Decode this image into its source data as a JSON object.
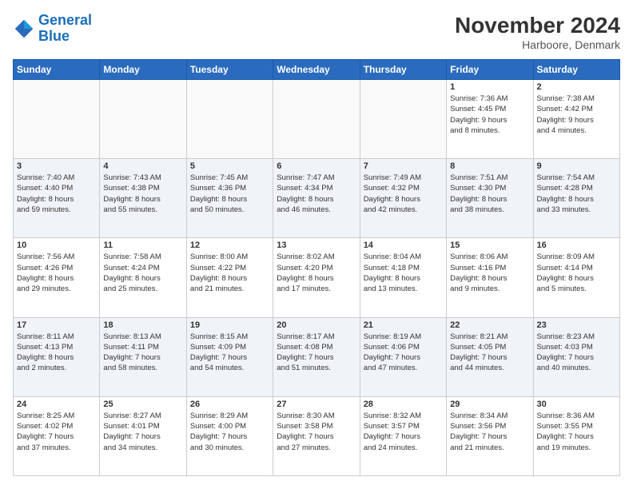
{
  "header": {
    "logo_line1": "General",
    "logo_line2": "Blue",
    "month_title": "November 2024",
    "location": "Harboore, Denmark"
  },
  "weekdays": [
    "Sunday",
    "Monday",
    "Tuesday",
    "Wednesday",
    "Thursday",
    "Friday",
    "Saturday"
  ],
  "weeks": [
    [
      {
        "day": "",
        "info": ""
      },
      {
        "day": "",
        "info": ""
      },
      {
        "day": "",
        "info": ""
      },
      {
        "day": "",
        "info": ""
      },
      {
        "day": "",
        "info": ""
      },
      {
        "day": "1",
        "info": "Sunrise: 7:36 AM\nSunset: 4:45 PM\nDaylight: 9 hours\nand 8 minutes."
      },
      {
        "day": "2",
        "info": "Sunrise: 7:38 AM\nSunset: 4:42 PM\nDaylight: 9 hours\nand 4 minutes."
      }
    ],
    [
      {
        "day": "3",
        "info": "Sunrise: 7:40 AM\nSunset: 4:40 PM\nDaylight: 8 hours\nand 59 minutes."
      },
      {
        "day": "4",
        "info": "Sunrise: 7:43 AM\nSunset: 4:38 PM\nDaylight: 8 hours\nand 55 minutes."
      },
      {
        "day": "5",
        "info": "Sunrise: 7:45 AM\nSunset: 4:36 PM\nDaylight: 8 hours\nand 50 minutes."
      },
      {
        "day": "6",
        "info": "Sunrise: 7:47 AM\nSunset: 4:34 PM\nDaylight: 8 hours\nand 46 minutes."
      },
      {
        "day": "7",
        "info": "Sunrise: 7:49 AM\nSunset: 4:32 PM\nDaylight: 8 hours\nand 42 minutes."
      },
      {
        "day": "8",
        "info": "Sunrise: 7:51 AM\nSunset: 4:30 PM\nDaylight: 8 hours\nand 38 minutes."
      },
      {
        "day": "9",
        "info": "Sunrise: 7:54 AM\nSunset: 4:28 PM\nDaylight: 8 hours\nand 33 minutes."
      }
    ],
    [
      {
        "day": "10",
        "info": "Sunrise: 7:56 AM\nSunset: 4:26 PM\nDaylight: 8 hours\nand 29 minutes."
      },
      {
        "day": "11",
        "info": "Sunrise: 7:58 AM\nSunset: 4:24 PM\nDaylight: 8 hours\nand 25 minutes."
      },
      {
        "day": "12",
        "info": "Sunrise: 8:00 AM\nSunset: 4:22 PM\nDaylight: 8 hours\nand 21 minutes."
      },
      {
        "day": "13",
        "info": "Sunrise: 8:02 AM\nSunset: 4:20 PM\nDaylight: 8 hours\nand 17 minutes."
      },
      {
        "day": "14",
        "info": "Sunrise: 8:04 AM\nSunset: 4:18 PM\nDaylight: 8 hours\nand 13 minutes."
      },
      {
        "day": "15",
        "info": "Sunrise: 8:06 AM\nSunset: 4:16 PM\nDaylight: 8 hours\nand 9 minutes."
      },
      {
        "day": "16",
        "info": "Sunrise: 8:09 AM\nSunset: 4:14 PM\nDaylight: 8 hours\nand 5 minutes."
      }
    ],
    [
      {
        "day": "17",
        "info": "Sunrise: 8:11 AM\nSunset: 4:13 PM\nDaylight: 8 hours\nand 2 minutes."
      },
      {
        "day": "18",
        "info": "Sunrise: 8:13 AM\nSunset: 4:11 PM\nDaylight: 7 hours\nand 58 minutes."
      },
      {
        "day": "19",
        "info": "Sunrise: 8:15 AM\nSunset: 4:09 PM\nDaylight: 7 hours\nand 54 minutes."
      },
      {
        "day": "20",
        "info": "Sunrise: 8:17 AM\nSunset: 4:08 PM\nDaylight: 7 hours\nand 51 minutes."
      },
      {
        "day": "21",
        "info": "Sunrise: 8:19 AM\nSunset: 4:06 PM\nDaylight: 7 hours\nand 47 minutes."
      },
      {
        "day": "22",
        "info": "Sunrise: 8:21 AM\nSunset: 4:05 PM\nDaylight: 7 hours\nand 44 minutes."
      },
      {
        "day": "23",
        "info": "Sunrise: 8:23 AM\nSunset: 4:03 PM\nDaylight: 7 hours\nand 40 minutes."
      }
    ],
    [
      {
        "day": "24",
        "info": "Sunrise: 8:25 AM\nSunset: 4:02 PM\nDaylight: 7 hours\nand 37 minutes."
      },
      {
        "day": "25",
        "info": "Sunrise: 8:27 AM\nSunset: 4:01 PM\nDaylight: 7 hours\nand 34 minutes."
      },
      {
        "day": "26",
        "info": "Sunrise: 8:29 AM\nSunset: 4:00 PM\nDaylight: 7 hours\nand 30 minutes."
      },
      {
        "day": "27",
        "info": "Sunrise: 8:30 AM\nSunset: 3:58 PM\nDaylight: 7 hours\nand 27 minutes."
      },
      {
        "day": "28",
        "info": "Sunrise: 8:32 AM\nSunset: 3:57 PM\nDaylight: 7 hours\nand 24 minutes."
      },
      {
        "day": "29",
        "info": "Sunrise: 8:34 AM\nSunset: 3:56 PM\nDaylight: 7 hours\nand 21 minutes."
      },
      {
        "day": "30",
        "info": "Sunrise: 8:36 AM\nSunset: 3:55 PM\nDaylight: 7 hours\nand 19 minutes."
      }
    ]
  ]
}
